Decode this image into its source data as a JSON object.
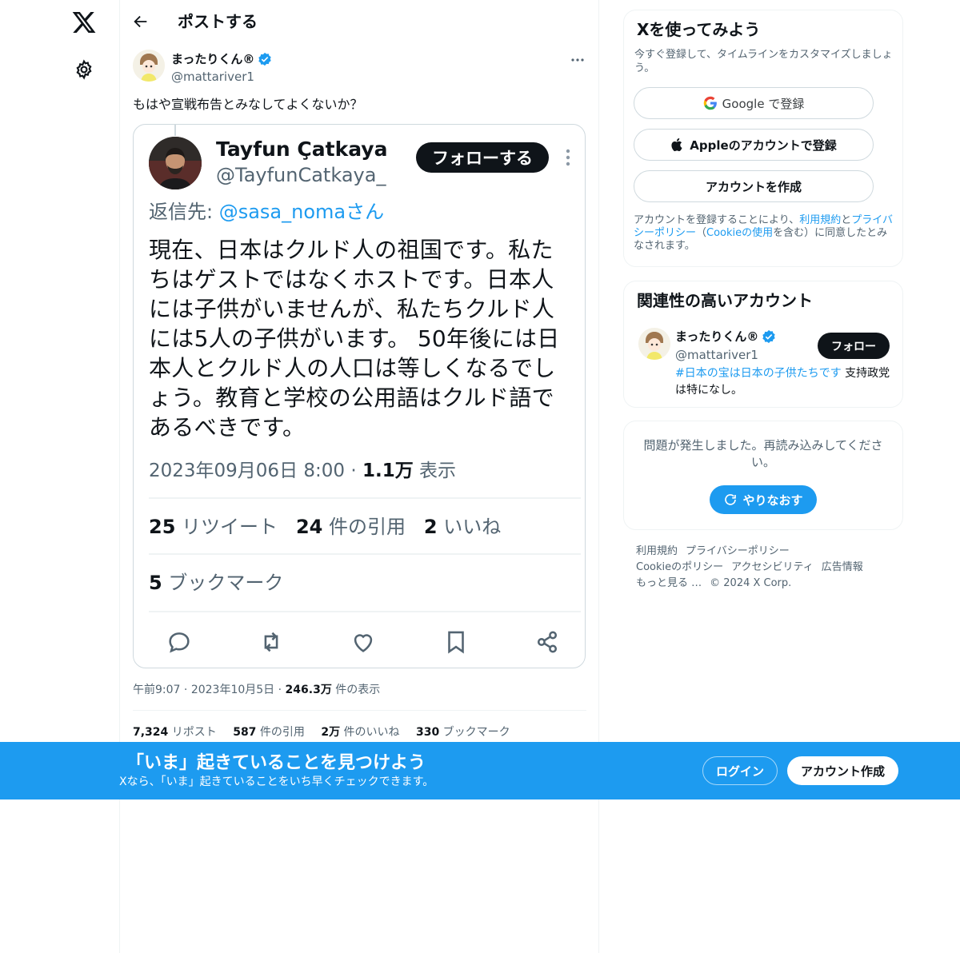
{
  "nav": {
    "logo_icon": "x-logo-icon",
    "settings_icon": "gear-icon"
  },
  "header": {
    "title": "ポストする"
  },
  "post": {
    "author_name": "まったりくん®",
    "author_handle": "@mattariver1",
    "text": "もはや宣戦布告とみなしてよくないか？",
    "meta_time": "午前9:07",
    "meta_date": "2023年10月5日",
    "meta_views_value": "246.3万",
    "meta_views_label": " 件の表示",
    "stats": [
      {
        "value": "7,324",
        "label": " リポスト"
      },
      {
        "value": "587",
        "label": " 件の引用"
      },
      {
        "value": "2万",
        "label": " 件のいいね"
      },
      {
        "value": "330",
        "label": " ブックマーク"
      }
    ]
  },
  "embedded": {
    "name": "Tayfun Çatkaya",
    "handle": "@TayfunCatkaya_",
    "follow_label": "フォローする",
    "reply_prefix": "返信先: ",
    "reply_handle": "@sasa_nomaさん",
    "body": "現在、日本はクルド人の祖国です。私たちはゲストではなくホストです。日本人には子供がいませんが、私たちクルド人には5人の子供がいます。 50年後には日本人とクルド人の人口は等しくなるでしょう。教育と学校の公用語はクルド語であるべきです。",
    "date": "2023年09月06日 8:00 · ",
    "views_value": "1.1万",
    "views_label": " 表示",
    "retweets_value": "25",
    "retweets_label": " リツイート",
    "quotes_value": "24",
    "quotes_label": " 件の引用",
    "likes_value": "2",
    "likes_label": " いいね",
    "bookmarks_value": "5",
    "bookmarks_label": " ブックマーク"
  },
  "signup_panel": {
    "title": "Xを使ってみよう",
    "subtitle": "今すぐ登録して、タイムラインをカスタマイズしましょう。",
    "google_label": "Google で登録",
    "apple_label": "Appleのアカウントで登録",
    "create_label": "アカウントを作成",
    "terms_1": "アカウントを登録することにより、",
    "terms_link1": "利用規約",
    "terms_2": "と",
    "terms_link2": "プライバシーポリシー",
    "terms_3": "（",
    "terms_link3": "Cookieの使用",
    "terms_4": "を含む）に同意したとみなされます。"
  },
  "related": {
    "title": "関連性の高いアカウント",
    "name": "まったりくん®",
    "handle": "@mattariver1",
    "follow_label": "フォロー",
    "bio_tag": "#日本の宝は日本の子供たちです",
    "bio_rest": " 支持政党は特になし。"
  },
  "error_panel": {
    "message": "問題が発生しました。再読み込みしてください。",
    "retry_label": "やりなおす"
  },
  "footer": {
    "links": [
      "利用規約",
      "プライバシーポリシー",
      "Cookieのポリシー",
      "アクセシビリティ",
      "広告情報",
      "もっと見る …"
    ],
    "copyright": "© 2024 X Corp."
  },
  "bottom_bar": {
    "title": "「いま」起きていることを見つけよう",
    "subtitle": "Xなら、「いま」起きていることをいち早くチェックできます。",
    "login_label": "ログイン",
    "signup_label": "アカウント作成"
  },
  "colors": {
    "accent": "#1d9bf0",
    "text": "#0f1419",
    "muted": "#536471",
    "border": "#eff3f4"
  }
}
